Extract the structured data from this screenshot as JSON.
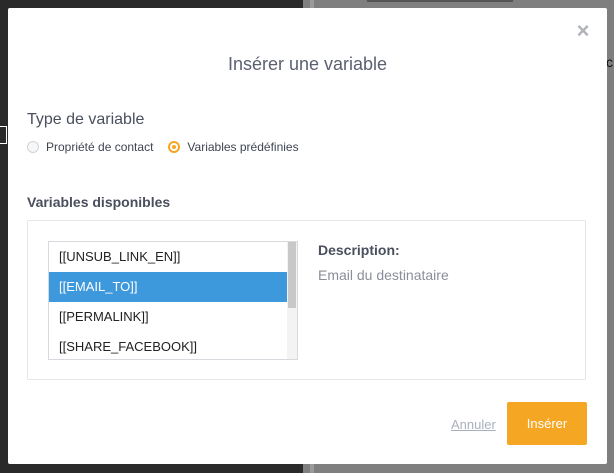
{
  "background": {
    "fragment_c": "c"
  },
  "modal": {
    "title": "Insérer une variable",
    "close_icon": "×",
    "variable_type": {
      "label": "Type de variable",
      "options": [
        {
          "label": "Propriété de contact",
          "checked": false
        },
        {
          "label": "Variables prédéfinies",
          "checked": true
        }
      ]
    },
    "available": {
      "label": "Variables disponibles",
      "items": [
        {
          "label": "[[UNSUB_LINK_EN]]",
          "selected": false
        },
        {
          "label": "[[EMAIL_TO]]",
          "selected": true
        },
        {
          "label": "[[PERMALINK]]",
          "selected": false
        },
        {
          "label": "[[SHARE_FACEBOOK]]",
          "selected": false
        }
      ],
      "description_label": "Description:",
      "description_text": "Email du destinataire"
    },
    "actions": {
      "cancel_label": "Annuler",
      "insert_label": "Insérer"
    }
  },
  "colors": {
    "accent": "#f5a623",
    "selection": "#3d98dc"
  }
}
